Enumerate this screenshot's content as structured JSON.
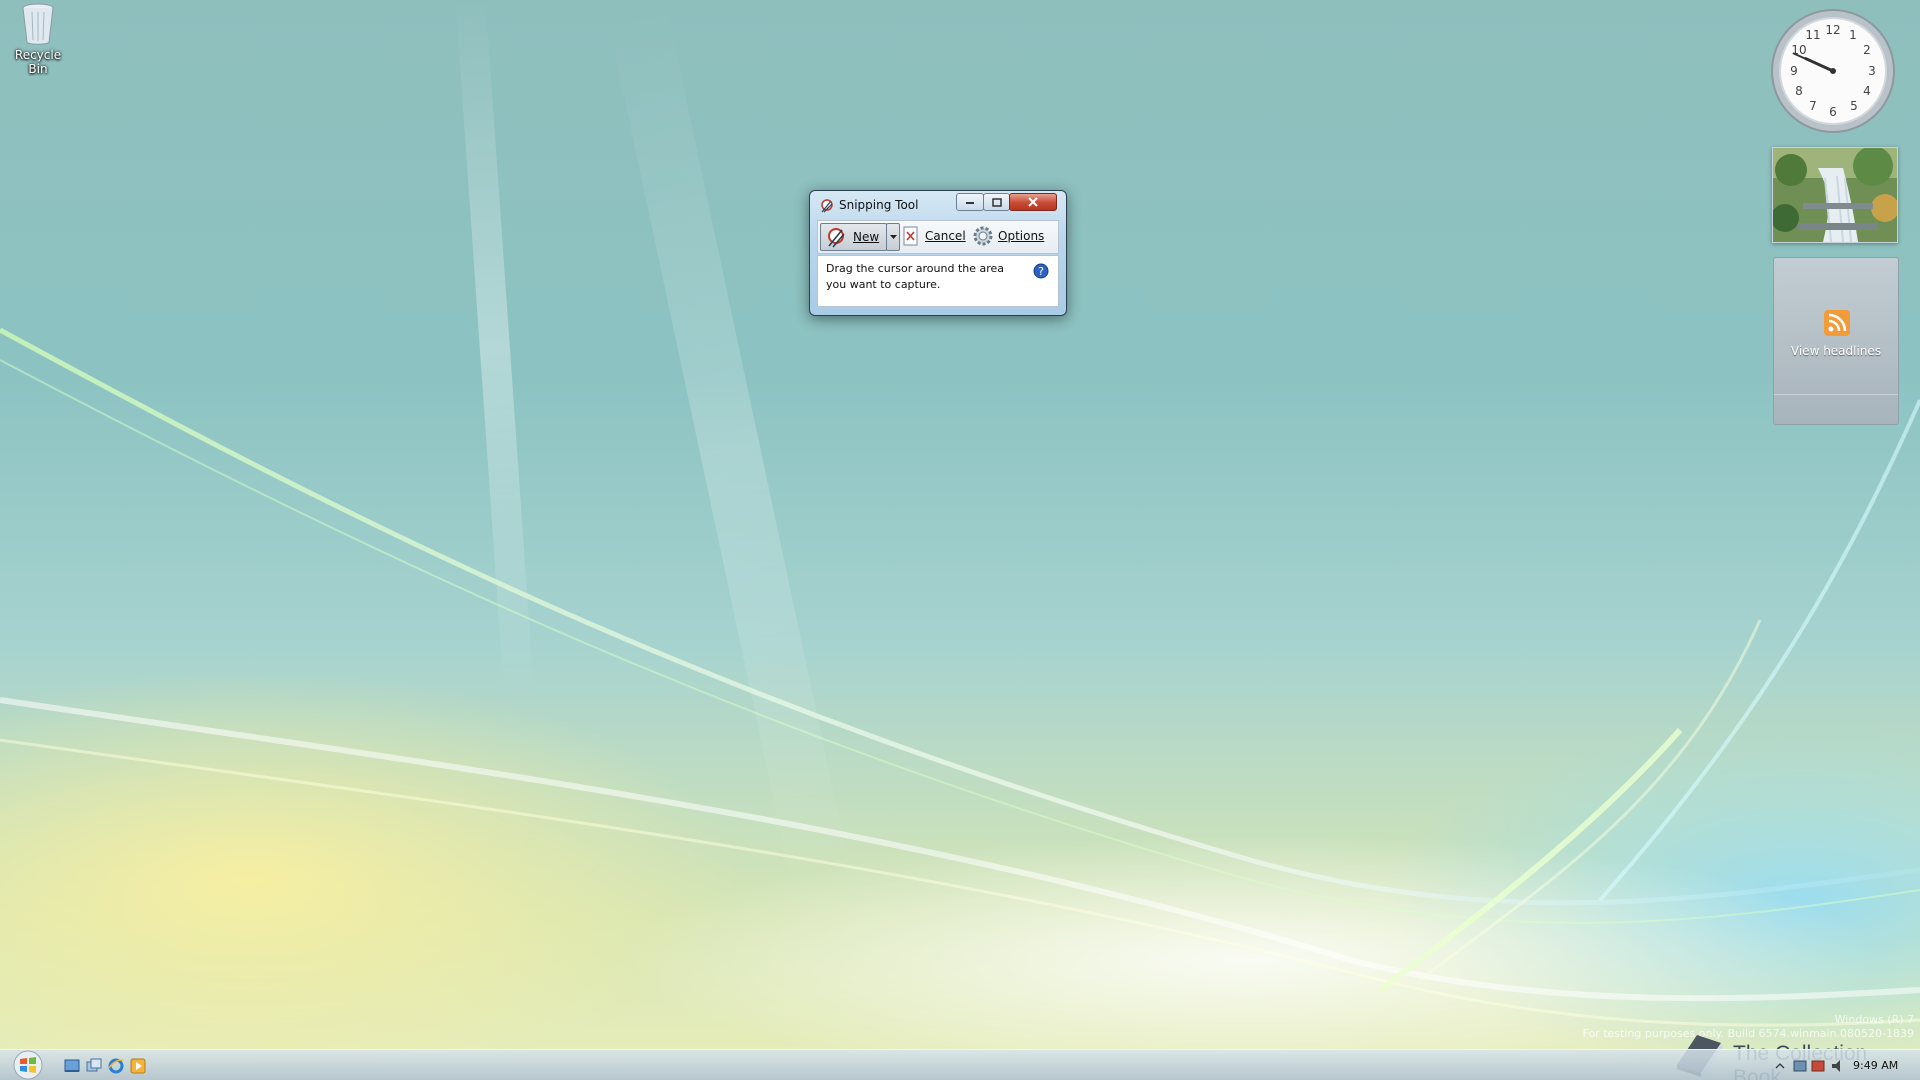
{
  "desktop": {
    "icons": [
      {
        "label": "Recycle Bin",
        "icon": "recycle-bin-icon"
      }
    ],
    "watermark": {
      "line1": "Windows (R) 7",
      "line2": "For testing purposes only. Build 6574.winmain.080520-1839"
    },
    "brand_text": "The Collection Book"
  },
  "snipping_tool": {
    "title": "Snipping Tool",
    "buttons": {
      "new": "New",
      "cancel": "Cancel",
      "options": "Options"
    },
    "message": "Drag the cursor around the area you want to capture.",
    "icons": {
      "title": "scissors-icon",
      "new": "scissors-icon",
      "cancel": "cancel-x-icon",
      "options": "gear-icon",
      "help": "help-icon"
    }
  },
  "gadgets": {
    "clock": {
      "hour": 9,
      "minute": 49
    },
    "feed_label": "View headlines"
  },
  "taskbar": {
    "time": "9:49 AM",
    "quick_launch": [
      "show-desktop-icon",
      "switch-windows-icon",
      "internet-explorer-icon",
      "media-player-icon"
    ]
  },
  "colors": {
    "close_button": "#c64b36",
    "rss_orange": "#f29b3a",
    "help_blue": "#2b62c4"
  }
}
